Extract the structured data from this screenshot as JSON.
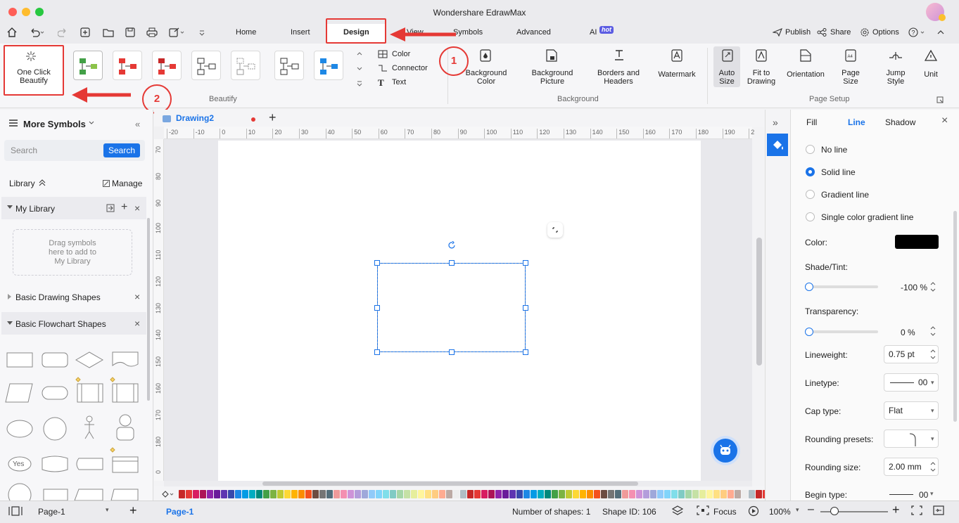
{
  "app_title": "Wondershare EdrawMax",
  "menu": [
    "Home",
    "Insert",
    "Design",
    "View",
    "Symbols",
    "Advanced",
    "AI"
  ],
  "ai_badge": "hot",
  "menu_right": {
    "publish": "Publish",
    "share": "Share",
    "options": "Options"
  },
  "ribbon": {
    "one_click": "One Click",
    "beautify_label": "Beautify",
    "color": "Color",
    "connector": "Connector",
    "text": "Text",
    "group_beautify": "Beautify",
    "bg_color_1": "Background",
    "bg_color_2": "Color",
    "bg_picture_1": "Background",
    "bg_picture_2": "Picture",
    "borders_1": "Borders and",
    "borders_2": "Headers",
    "watermark": "Watermark",
    "group_background": "Background",
    "auto_1": "Auto",
    "auto_2": "Size",
    "fit_1": "Fit to",
    "fit_2": "Drawing",
    "orientation": "Orientation",
    "pagesize_1": "Page",
    "pagesize_2": "Size",
    "jump_1": "Jump",
    "jump_2": "Style",
    "unit": "Unit",
    "group_pagesetup": "Page Setup"
  },
  "annotations": {
    "one": "1",
    "two": "2"
  },
  "left": {
    "title": "More Symbols",
    "search_placeholder": "Search",
    "search_button": "Search",
    "library": "Library",
    "manage": "Manage",
    "my_library": "My Library",
    "drop_text_1": "Drag symbols",
    "drop_text_2": "here to add to",
    "drop_text_3": "My Library",
    "basic_drawing": "Basic Drawing Shapes",
    "basic_flowchart": "Basic Flowchart Shapes",
    "yes_shape": "Yes"
  },
  "tab": {
    "name": "Drawing2"
  },
  "ruler_h": [
    "-20",
    "-10",
    "0",
    "10",
    "20",
    "30",
    "40",
    "50",
    "60",
    "70",
    "80",
    "90",
    "100",
    "110",
    "120",
    "130",
    "140",
    "150",
    "160",
    "170",
    "180",
    "190",
    "2"
  ],
  "ruler_v": [
    "70",
    "80",
    "90",
    "100",
    "110",
    "120",
    "130",
    "140",
    "150",
    "160",
    "170",
    "180",
    "0"
  ],
  "right": {
    "tabs": {
      "fill": "Fill",
      "line": "Line",
      "shadow": "Shadow"
    },
    "no_line": "No line",
    "solid_line": "Solid line",
    "gradient_line": "Gradient line",
    "single_gradient": "Single color gradient line",
    "color": "Color:",
    "shade": "Shade/Tint:",
    "shade_value": "-100 %",
    "transparency": "Transparency:",
    "transparency_value": "0 %",
    "lineweight": "Lineweight:",
    "lineweight_value": "0.75 pt",
    "linetype": "Linetype:",
    "linetype_value": "00",
    "cap": "Cap type:",
    "cap_value": "Flat",
    "rounding_presets": "Rounding presets:",
    "rounding_size": "Rounding size:",
    "rounding_size_value": "2.00 mm",
    "begin_type": "Begin type:",
    "begin_value": "00"
  },
  "status": {
    "page_select": "Page-1",
    "page_tab": "Page-1",
    "shapes": "Number of shapes: 1",
    "shape_id": "Shape ID: 106",
    "focus": "Focus",
    "zoom": "100%"
  },
  "palette": [
    "#c62828",
    "#e53935",
    "#d81b60",
    "#ad1457",
    "#8e24aa",
    "#6a1b9a",
    "#5e35b1",
    "#3949ab",
    "#1e88e5",
    "#039be5",
    "#00acc1",
    "#00897b",
    "#43a047",
    "#7cb342",
    "#c0ca33",
    "#fdd835",
    "#ffb300",
    "#fb8c00",
    "#f4511e",
    "#6d4c41",
    "#757575",
    "#546e7a",
    "#ef9a9a",
    "#f48fb1",
    "#ce93d8",
    "#b39ddb",
    "#9fa8da",
    "#90caf9",
    "#81d4fa",
    "#80deea",
    "#80cbc4",
    "#a5d6a7",
    "#c5e1a5",
    "#e6ee9c",
    "#fff59d",
    "#ffe082",
    "#ffcc80",
    "#ffab91",
    "#bcaaa4",
    "#eeeeee",
    "#b0bec5"
  ]
}
